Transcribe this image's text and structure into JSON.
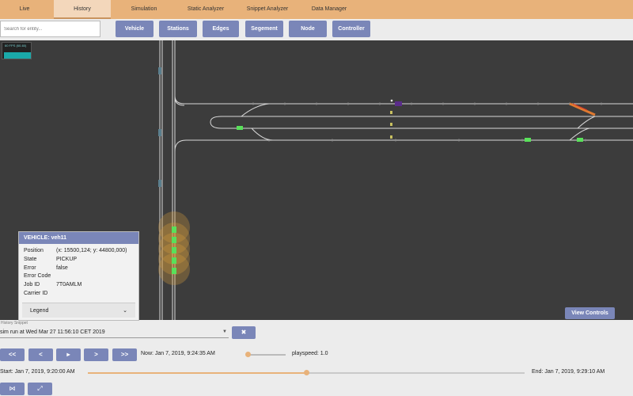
{
  "tabs": [
    {
      "label": "Live"
    },
    {
      "label": "History"
    },
    {
      "label": "Simulation"
    },
    {
      "label": "Static Analyzer"
    },
    {
      "label": "Snippet Analyzer"
    },
    {
      "label": "Data Manager"
    }
  ],
  "active_tab": "History",
  "toolbar": {
    "search_placeholder": "Search for entity...",
    "buttons": [
      {
        "label": "Vehicle"
      },
      {
        "label": "Stations"
      },
      {
        "label": "Edges"
      },
      {
        "label": "Segement"
      },
      {
        "label": "Node"
      },
      {
        "label": "Controller"
      }
    ]
  },
  "map": {
    "background": "#3c3c3c",
    "fps_text": "60 FPS (60-60)"
  },
  "vehicle_panel": {
    "title": "VEHICLE: veh11",
    "rows": [
      {
        "key": "Position",
        "value": "(x: 15500,124; y: 44800,000)"
      },
      {
        "key": "State",
        "value": "PICKUP"
      },
      {
        "key": "Error",
        "value": "false"
      },
      {
        "key": "Error Code",
        "value": ""
      },
      {
        "key": "Job ID",
        "value": "7T0AMLM"
      },
      {
        "key": "Carrier ID",
        "value": ""
      }
    ],
    "legend_label": "Legend",
    "legend_icon": "chevron-down-icon"
  },
  "view_controls_label": "View Controls",
  "history": {
    "label": "History Snippet",
    "selected": "sim run at Wed Mar 27 11:56:10 CET 2019",
    "clear_icon": "✖"
  },
  "playback": {
    "buttons": [
      "<<",
      "<",
      "▸",
      ">",
      ">>"
    ],
    "now_text": "Now: Jan 7, 2019, 9:24:35 AM",
    "playspeed_text": "playspeed: 1.0",
    "playspeed_level": 0.05,
    "start_text": "Start: Jan 7, 2019, 9:20:00 AM",
    "end_text": "End: Jan 7, 2019, 9:29:10 AM",
    "timeline_progress": 0.5
  },
  "bottom_buttons": [
    "⋈",
    "⤢"
  ],
  "colors": {
    "accent": "#e8b27a",
    "button": "#7a86b8",
    "vehicle_green": "#59e05a",
    "vehicle_orange": "#e07a30",
    "vehicle_purple": "#5a2c8a"
  }
}
